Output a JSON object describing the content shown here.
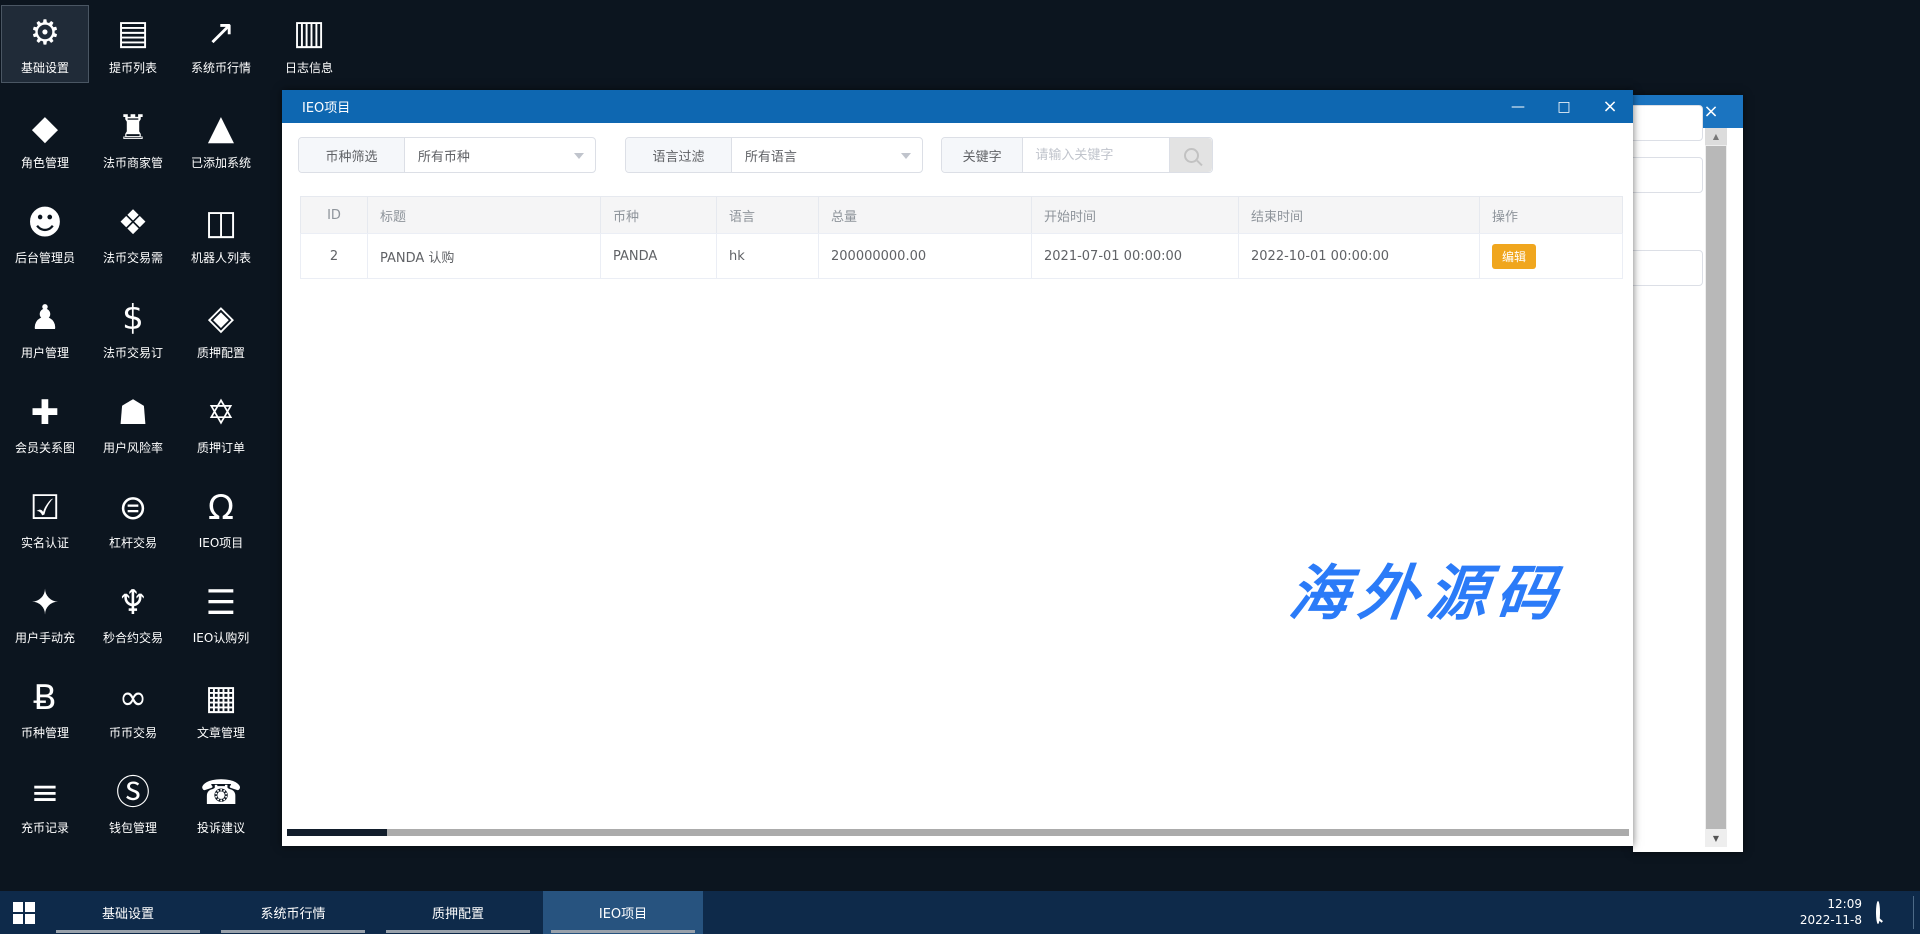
{
  "desktop": {
    "watermark": "海外源码",
    "icon_rows": [
      [
        {
          "name": "basic-settings",
          "icon": "gear",
          "glyph": "⚙",
          "label": "基础设置",
          "selected": true
        },
        {
          "name": "withdraw-list",
          "icon": "bank-card",
          "glyph": "▤",
          "label": "提币列表"
        },
        {
          "name": "system-coin-market",
          "icon": "line-chart",
          "glyph": "↗",
          "label": "系统币行情"
        },
        {
          "name": "log-info",
          "icon": "document",
          "glyph": "▥",
          "label": "日志信息"
        }
      ],
      [
        {
          "name": "role-management",
          "icon": "graduation-cap",
          "glyph": "◆",
          "label": "角色管理"
        },
        {
          "name": "fiat-merchant-management",
          "icon": "bank",
          "glyph": "♜",
          "label": "法币商家管"
        },
        {
          "name": "added-system",
          "icon": "area-chart",
          "glyph": "▲",
          "label": "已添加系统"
        }
      ],
      [
        {
          "name": "admin-manager",
          "icon": "user-circle",
          "glyph": "☻",
          "label": "后台管理员"
        },
        {
          "name": "fiat-trade-demand",
          "icon": "diamond",
          "glyph": "❖",
          "label": "法币交易需"
        },
        {
          "name": "robot-list",
          "icon": "robot",
          "glyph": "◫",
          "label": "机器人列表"
        }
      ],
      [
        {
          "name": "user-management",
          "icon": "users",
          "glyph": "♟",
          "label": "用户管理"
        },
        {
          "name": "fiat-trade-order",
          "icon": "dollar",
          "glyph": "$",
          "label": "法币交易订"
        },
        {
          "name": "pledge-config",
          "icon": "cube",
          "glyph": "◈",
          "label": "质押配置"
        }
      ],
      [
        {
          "name": "member-relation-graph",
          "icon": "user-plus",
          "glyph": "✚",
          "label": "会员关系图"
        },
        {
          "name": "user-risk-rate",
          "icon": "shield",
          "glyph": "☗",
          "label": "用户风险率"
        },
        {
          "name": "pledge-order",
          "icon": "hexagon",
          "glyph": "✡",
          "label": "质押订单"
        }
      ],
      [
        {
          "name": "realname-auth",
          "icon": "check-square",
          "glyph": "☑",
          "label": "实名认证"
        },
        {
          "name": "leverage-trade",
          "icon": "circle-lines",
          "glyph": "⊜",
          "label": "杠杆交易"
        },
        {
          "name": "ieo-project",
          "icon": "unlock",
          "glyph": "Ω",
          "label": "IEO项目"
        }
      ],
      [
        {
          "name": "user-manual-recharge",
          "icon": "puzzle",
          "glyph": "✦",
          "label": "用户手动充"
        },
        {
          "name": "second-contract-trade",
          "icon": "emblem",
          "glyph": "♆",
          "label": "秒合约交易"
        },
        {
          "name": "ieo-subscribe-list",
          "icon": "list",
          "glyph": "☰",
          "label": "IEO认购列"
        }
      ],
      [
        {
          "name": "coin-management",
          "icon": "bitcoin",
          "glyph": "Ƀ",
          "label": "币种管理"
        },
        {
          "name": "coin-trade",
          "icon": "mastercard",
          "glyph": "∞",
          "label": "币币交易"
        },
        {
          "name": "article-management",
          "icon": "newspaper",
          "glyph": "▦",
          "label": "文章管理"
        }
      ],
      [
        {
          "name": "recharge-record",
          "icon": "list-lines",
          "glyph": "≡",
          "label": "充币记录"
        },
        {
          "name": "wallet-management",
          "icon": "skype",
          "glyph": "Ⓢ",
          "label": "钱包管理"
        },
        {
          "name": "complaint-suggestion",
          "icon": "phone",
          "glyph": "☎",
          "label": "投诉建议"
        }
      ]
    ]
  },
  "window": {
    "title": "IEO项目",
    "controls": {
      "minimize": "—",
      "maximize": "□",
      "close": "×"
    },
    "filters": {
      "currency": {
        "label": "币种筛选",
        "value": "所有币种"
      },
      "language": {
        "label": "语言过滤",
        "value": "所有语言"
      },
      "keyword": {
        "label": "关键字",
        "placeholder": "请输入关键字"
      }
    },
    "table": {
      "headers": [
        "ID",
        "标题",
        "币种",
        "语言",
        "总量",
        "开始时间",
        "结束时间",
        "操作"
      ],
      "rows": [
        [
          "2",
          "PANDA 认购",
          "PANDA",
          "hk",
          "200000000.00",
          "2021-07-01 00:00:00",
          "2022-10-01 00:00:00"
        ]
      ],
      "edit_label": "编辑"
    }
  },
  "back_window": {
    "controls": {
      "maximize": "□",
      "close": "×"
    },
    "scroll_up": "▲",
    "scroll_down": "▼"
  },
  "taskbar": {
    "items": [
      {
        "label": "基础设置",
        "active": false
      },
      {
        "label": "系统币行情",
        "active": false
      },
      {
        "label": "质押配置",
        "active": false
      },
      {
        "label": "IEO项目",
        "active": true
      }
    ],
    "clock": {
      "time": "12:09",
      "date": "2022-11-8"
    }
  },
  "colors": {
    "titlebar_blue": "#0e67b1",
    "taskbar_navy": "#0e2a4a",
    "taskbar_active": "#27537f",
    "edit_button_amber": "#f0a61e",
    "watermark_blue": "#2b7bf8",
    "desktop_bg": "#0c151f"
  }
}
